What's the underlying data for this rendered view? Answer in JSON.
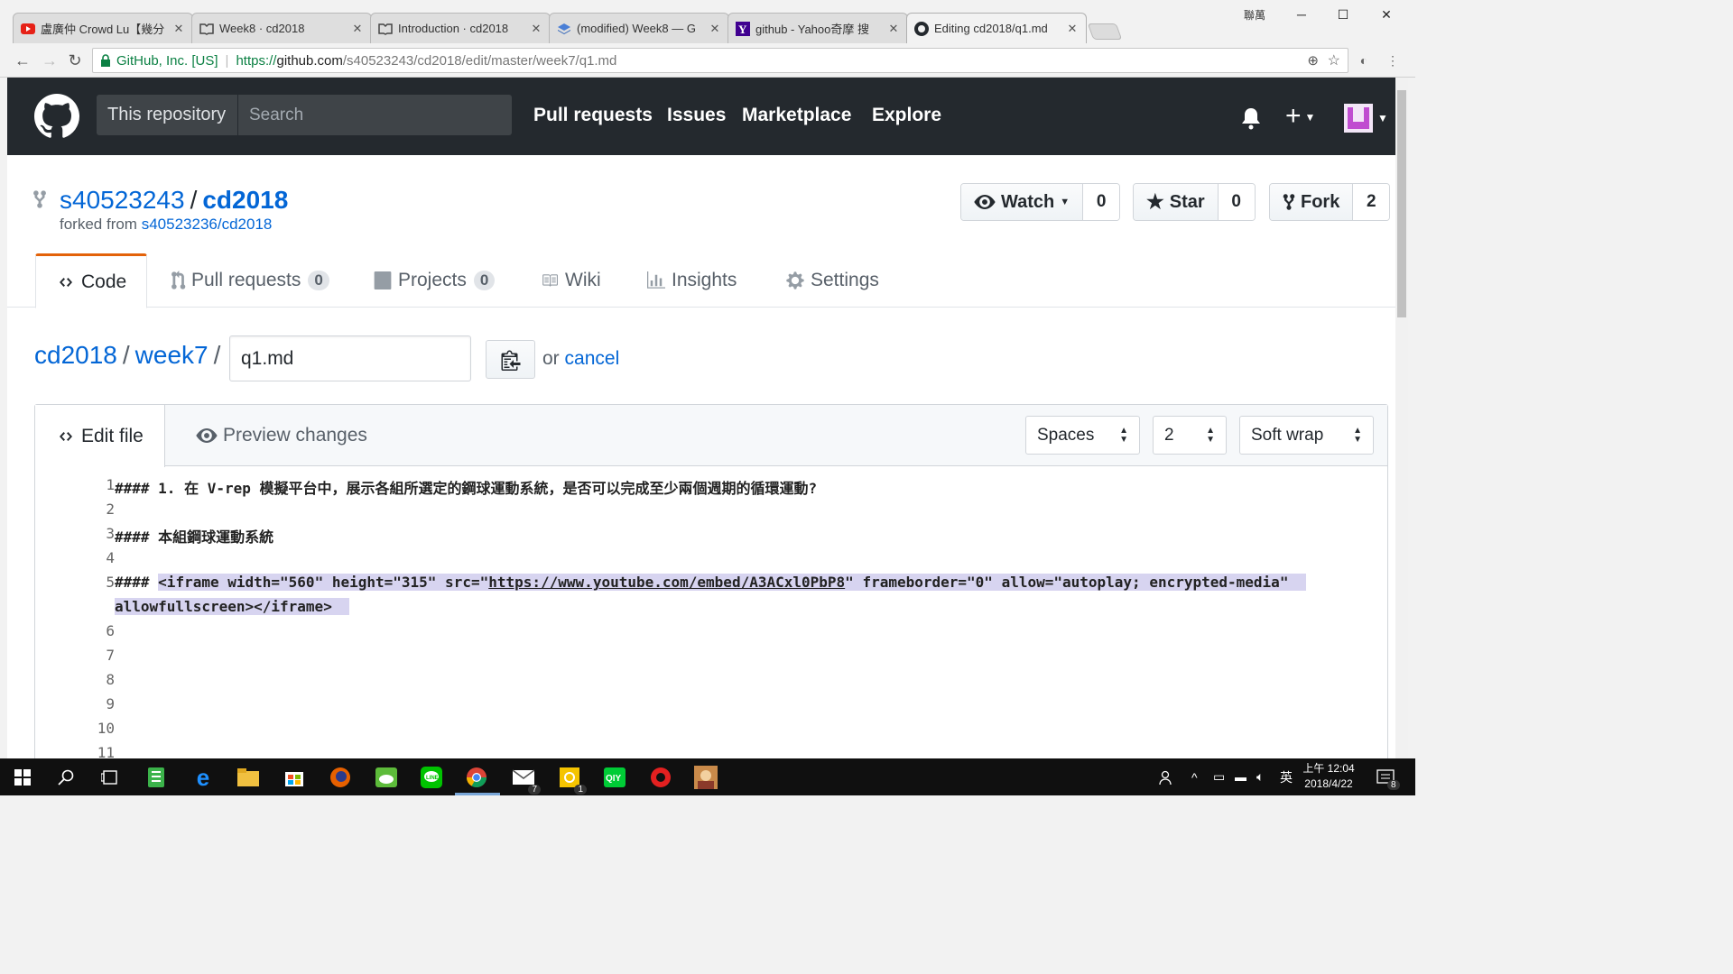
{
  "browser": {
    "tabs": [
      {
        "title": "盧廣仲 Crowd Lu【幾分",
        "icon": "youtube-icon"
      },
      {
        "title": "Week8 · cd2018",
        "icon": "book-icon"
      },
      {
        "title": "Introduction · cd2018",
        "icon": "book-icon"
      },
      {
        "title": "(modified) Week8 — G",
        "icon": "layers-icon"
      },
      {
        "title": "github - Yahoo奇摩 搜",
        "icon": "yahoo-icon"
      },
      {
        "title": "Editing cd2018/q1.md",
        "icon": "github-icon"
      }
    ],
    "window_user": "聯萬",
    "url_secure_label": "GitHub, Inc. [US]",
    "url_scheme": "https://",
    "url_host": "github.com",
    "url_path": "/s40523243/cd2018/edit/master/week7/q1.md"
  },
  "header": {
    "scope": "This repository",
    "search_placeholder": "Search",
    "nav": [
      "Pull requests",
      "Issues",
      "Marketplace",
      "Explore"
    ]
  },
  "repo": {
    "owner": "s40523243",
    "name": "cd2018",
    "forked_prefix": "forked from",
    "forked_from": "s40523236/cd2018",
    "watch_label": "Watch",
    "watch_count": "0",
    "star_label": "Star",
    "star_count": "0",
    "fork_label": "Fork",
    "fork_count": "2"
  },
  "reponav": {
    "code": "Code",
    "pulls": "Pull requests",
    "pulls_count": "0",
    "projects": "Projects",
    "projects_count": "0",
    "wiki": "Wiki",
    "insights": "Insights",
    "settings": "Settings"
  },
  "breadcrumb": {
    "root": "cd2018",
    "folder": "week7",
    "filename": "q1.md",
    "or_text": "or",
    "cancel": "cancel"
  },
  "editor": {
    "edit_tab": "Edit file",
    "preview_tab": "Preview changes",
    "indent_mode": "Spaces",
    "indent_size": "2",
    "wrap_mode": "Soft wrap",
    "lines": [
      {
        "n": "1",
        "text": "#### 1. 在 V-rep 模擬平台中，展示各組所選定的鋼球運動系統，是否可以完成至少兩個週期的循環運動?"
      },
      {
        "n": "2",
        "text": ""
      },
      {
        "n": "3",
        "text": "#### 本組鋼球運動系統"
      },
      {
        "n": "4",
        "text": ""
      },
      {
        "n": "5",
        "prefix": "#### ",
        "before": "<iframe width=\"560\" height=\"315\" src=\"",
        "link": "https://www.youtube.com/embed/A3ACxl0PbP8",
        "after": "\" frameborder=\"0\" allow=\"autoplay; encrypted-media\"",
        "wrap": "allowfullscreen></iframe>"
      },
      {
        "n": "6",
        "text": ""
      },
      {
        "n": "7",
        "text": ""
      },
      {
        "n": "8",
        "text": ""
      },
      {
        "n": "9",
        "text": ""
      },
      {
        "n": "10",
        "text": ""
      },
      {
        "n": "11",
        "text": ""
      }
    ]
  },
  "taskbar": {
    "clock_time": "上午 12:04",
    "clock_date": "2018/4/22",
    "ime": "英",
    "mail_badge": "7",
    "app_badge": "1",
    "notif_count": "8"
  }
}
